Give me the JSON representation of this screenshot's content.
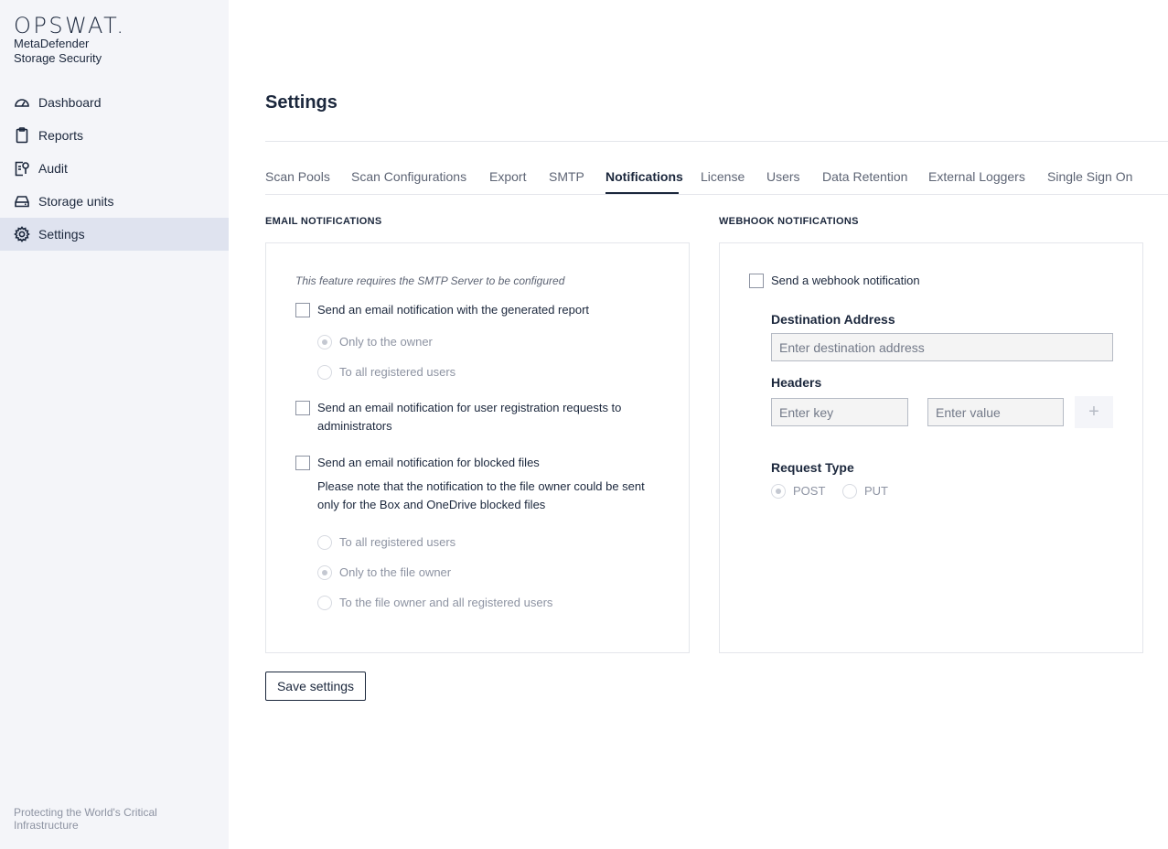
{
  "brand": {
    "logo": "OPSWAT.",
    "product_line1": "MetaDefender",
    "product_line2": "Storage Security",
    "footer": "Protecting the World's Critical Infrastructure"
  },
  "sidebar": {
    "items": [
      {
        "label": "Dashboard",
        "icon": "gauge-icon"
      },
      {
        "label": "Reports",
        "icon": "clipboard-icon"
      },
      {
        "label": "Audit",
        "icon": "audit-icon"
      },
      {
        "label": "Storage units",
        "icon": "drive-icon"
      },
      {
        "label": "Settings",
        "icon": "gear-icon",
        "active": true
      }
    ]
  },
  "page": {
    "title": "Settings"
  },
  "tabs": [
    {
      "label": "Scan Pools"
    },
    {
      "label": "Scan Configurations"
    },
    {
      "label": "Export"
    },
    {
      "label": "SMTP"
    },
    {
      "label": "Notifications",
      "active": true
    },
    {
      "label": "License"
    },
    {
      "label": "Users"
    },
    {
      "label": "Data Retention"
    },
    {
      "label": "External Loggers"
    },
    {
      "label": "Single Sign On"
    }
  ],
  "email": {
    "heading": "EMAIL NOTIFICATIONS",
    "note": "This feature requires the SMTP Server to be configured",
    "report_checkbox": "Send an email notification with the generated report",
    "report_options": [
      {
        "label": "Only to the owner",
        "checked": true
      },
      {
        "label": "To all registered users",
        "checked": false
      }
    ],
    "registration_checkbox_line1": "Send an email notification for user registration requests to",
    "registration_checkbox_line2": "administrators",
    "blocked_checkbox": "Send an email notification for blocked files",
    "blocked_note_line1": "Please note that the notification to the file owner could be sent",
    "blocked_note_line2": "only for the Box and OneDrive blocked files",
    "blocked_options": [
      {
        "label": "To all registered users",
        "checked": false
      },
      {
        "label": "Only to the file owner",
        "checked": true
      },
      {
        "label": "To the file owner and all registered users",
        "checked": false
      }
    ]
  },
  "webhook": {
    "heading": "WEBHOOK NOTIFICATIONS",
    "checkbox": "Send a webhook notification",
    "destination_label": "Destination Address",
    "destination_placeholder": "Enter destination address",
    "headers_label": "Headers",
    "key_placeholder": "Enter key",
    "value_placeholder": "Enter value",
    "add_symbol": "+",
    "request_type_label": "Request Type",
    "request_types": [
      {
        "label": "POST",
        "checked": true
      },
      {
        "label": "PUT",
        "checked": false
      }
    ]
  },
  "actions": {
    "save_label": "Save settings"
  }
}
